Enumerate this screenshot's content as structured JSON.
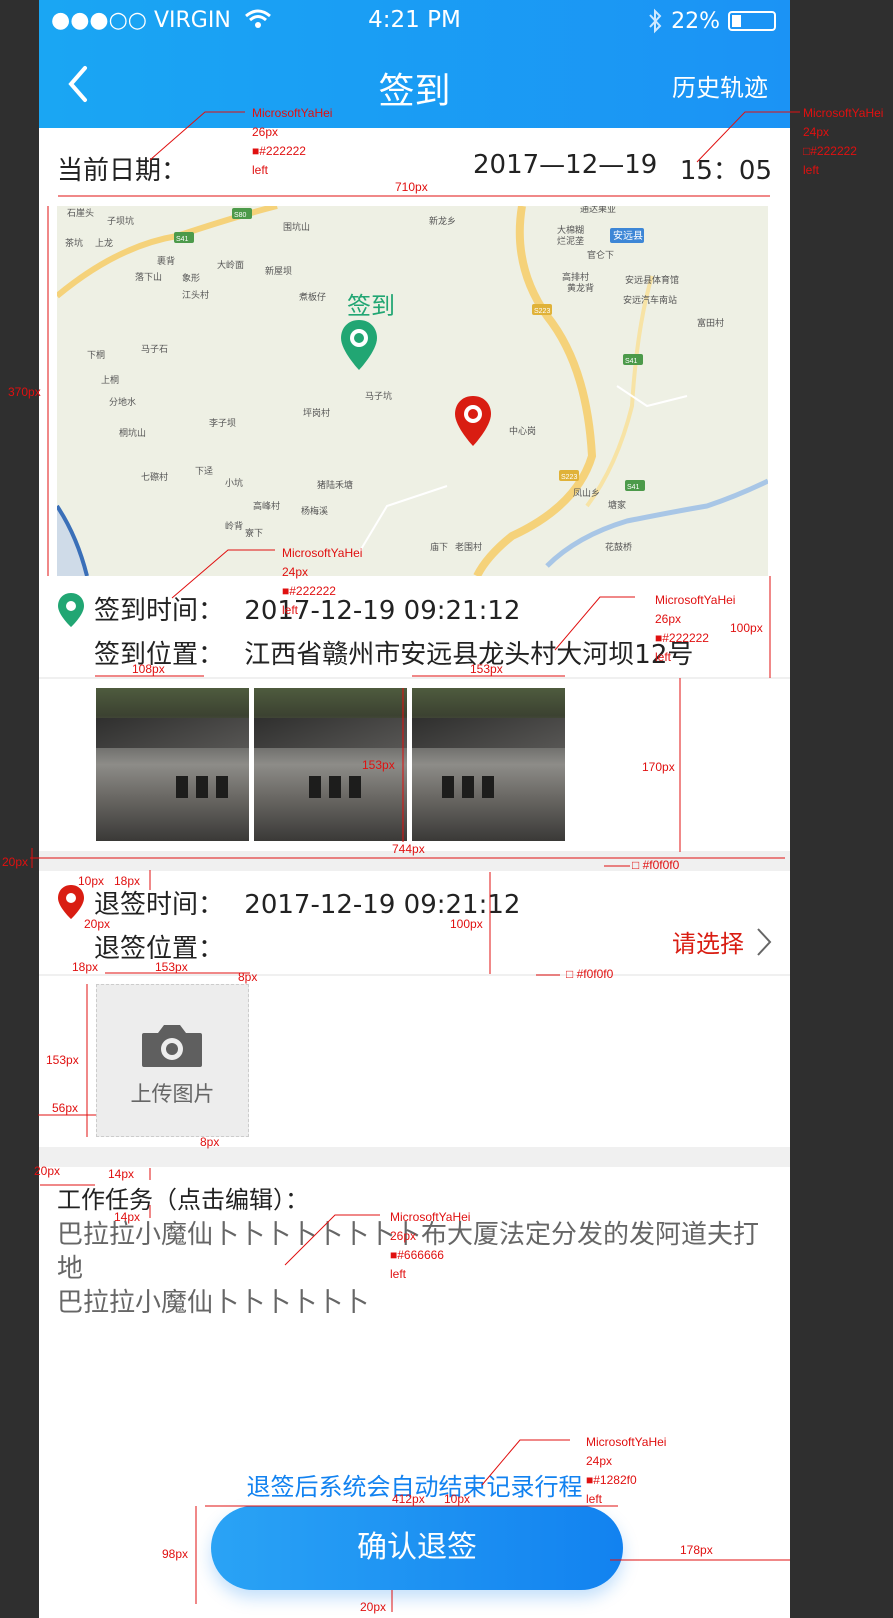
{
  "status_bar": {
    "signal_text": "●●●○○",
    "carrier": "VIRGIN",
    "time": "4:21 PM",
    "battery": "22%",
    "battery_fraction": 0.22
  },
  "nav": {
    "title": "签到",
    "history_label": "历史轨迹"
  },
  "date_row": {
    "label": "当前日期：",
    "date": "2017—12—19",
    "time": "15：05"
  },
  "map": {
    "signin_marker_label": "签到",
    "labels": [
      "子坝坑",
      "茶坑",
      "上龙",
      "裹背",
      "大岭面",
      "落下山",
      "象形",
      "江头村",
      "新屋坝",
      "围坑山",
      "新龙乡",
      "通达果业",
      "大棉糊",
      "烂泥垄",
      "官仑下",
      "安远县",
      "高排村",
      "黄龙背",
      "安远县体育馆",
      "安远汽车南站",
      "富田村",
      "煮板仔",
      "马子石",
      "下桐",
      "上桐",
      "分地水",
      "桐坑山",
      "马子坑",
      "坪岗村",
      "李子坝",
      "中心岗",
      "七磜村",
      "下迳",
      "小坑",
      "猪陆禾塘",
      "寮下",
      "凤山乡",
      "塘家",
      "高峰村",
      "杨梅溪",
      "岭背",
      "庙下",
      "老围村",
      "花鼓桥",
      "石崖头"
    ],
    "road_badges": [
      "S80",
      "S41",
      "S223",
      "S41",
      "S223",
      "S41"
    ]
  },
  "signin": {
    "time_label": "签到时间：",
    "time_value": "2017-12-19 09:21:12",
    "location_label": "签到位置：",
    "location_value": "江西省赣州市安远县龙头村大河坝12号"
  },
  "signout": {
    "time_label": "退签时间：",
    "time_value": "2017-12-19 09:21:12",
    "location_label": "退签位置：",
    "select_label": "请选择"
  },
  "upload": {
    "label": "上传图片"
  },
  "task": {
    "title": "工作任务（点击编辑）：",
    "line1": "巴拉拉小魔仙卜卜卜卜卜卜卜卜布大厦法定分发的发阿道夫打地",
    "line2": "巴拉拉小魔仙卜卜卜卜卜卜"
  },
  "notice": "退签后系统会自动结束记录行程",
  "confirm_label": "确认退签",
  "colors": {
    "header_blue": "#1aa6f3",
    "text_primary": "#222222",
    "text_secondary": "#666666",
    "accent_blue": "#1282f0",
    "signin_green": "#21a673",
    "signout_red": "#d91d12",
    "divider": "#f0f0f0"
  },
  "annotations": {
    "a1": [
      "MicrosoftYaHei",
      "26px",
      "■#222222",
      "left"
    ],
    "a2": [
      "MicrosoftYaHei",
      "24px",
      "□#222222",
      "left"
    ],
    "a3": [
      "MicrosoftYaHei",
      "24px",
      "■#222222",
      "left"
    ],
    "a4": [
      "MicrosoftYaHei",
      "26px",
      "■#222222",
      "left"
    ],
    "a5": [
      "MicrosoftYaHei",
      "26px",
      "■#666666",
      "left"
    ],
    "a6": [
      "MicrosoftYaHei",
      "24px",
      "■#1282f0",
      "left"
    ],
    "dims": [
      "710px",
      "370px",
      "100px",
      "108px",
      "153px",
      "170px",
      "153px",
      "744px",
      "20px",
      "□ #f0f0f0",
      "10px",
      "18px",
      "20px",
      "100px",
      "18px",
      "153px",
      "8px",
      "□ #f0f0f0",
      "153px",
      "56px",
      "8px",
      "20px",
      "14px",
      "14px",
      "412px",
      "10px",
      "98px",
      "178px",
      "20px"
    ]
  }
}
